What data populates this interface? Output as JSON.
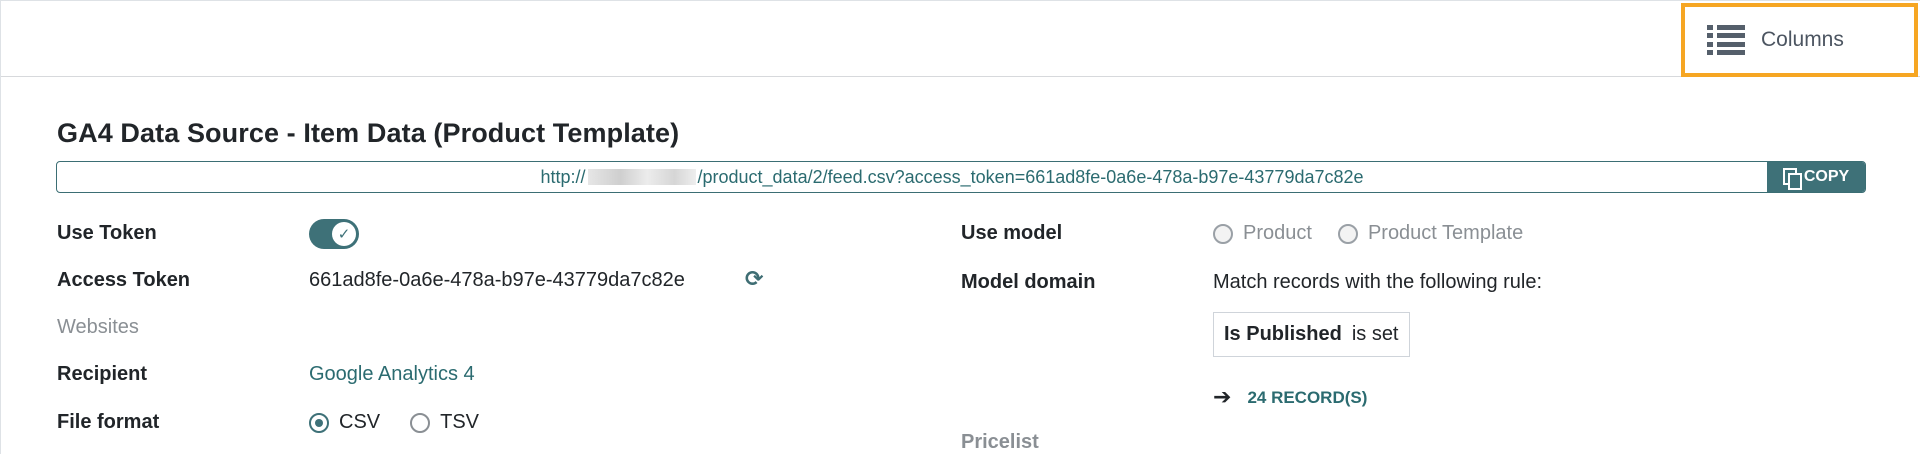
{
  "control_panel": {
    "columns_label": "Columns",
    "columns_icon": "list-icon"
  },
  "form": {
    "title": "GA4 Data Source - Item Data (Product Template)",
    "url": {
      "prefix": "http://",
      "suffix": "/product_data/2/feed.csv?access_token=661ad8fe-0a6e-478a-b97e-43779da7c82e",
      "copy_label": "COPY"
    },
    "left_fields": {
      "use_token_label": "Use Token",
      "use_token_value": "on",
      "access_token_label": "Access Token",
      "access_token_value": "661ad8fe-0a6e-478a-b97e-43779da7c82e",
      "websites_label": "Websites",
      "recipient_label": "Recipient",
      "recipient_value": "Google Analytics 4",
      "file_format_label": "File format",
      "file_format_options": [
        "CSV",
        "TSV"
      ],
      "file_format_selected": "CSV"
    },
    "right_fields": {
      "use_model_label": "Use model",
      "use_model_options": [
        "Product",
        "Product Template"
      ],
      "model_domain_label": "Model domain",
      "model_domain_rule_text": "Match records with the following rule:",
      "domain_field": "Is Published",
      "domain_operator": "is set",
      "records_link": "24 RECORD(S)",
      "pricelist_label": "Pricelist"
    }
  },
  "colors": {
    "accent": "#3e7178",
    "highlight_border": "#f6a623",
    "link": "#2b6b70"
  }
}
